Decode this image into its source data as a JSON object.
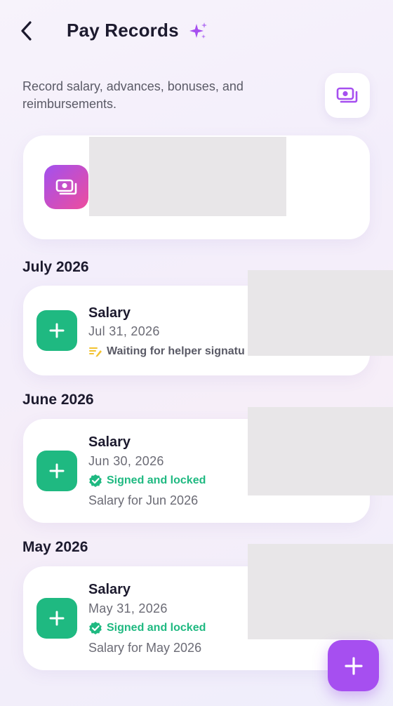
{
  "header": {
    "title": "Pay Records",
    "back_icon": "chevron-left-icon",
    "title_icon": "sparkle-icon"
  },
  "subtitle": "Record salary, advances, bonuses, and reimbursements.",
  "top_action": {
    "icon": "cash-icon"
  },
  "summary_card": {
    "icon": "cash-icon"
  },
  "sections": [
    {
      "title": "July 2026",
      "record": {
        "title": "Salary",
        "date": "Jul 31, 2026",
        "status": "Waiting for helper signatu",
        "status_icon": "signature-pending-icon",
        "status_color": "#5a5a66"
      }
    },
    {
      "title": "June 2026",
      "record": {
        "title": "Salary",
        "date": "Jun 30, 2026",
        "status": "Signed and locked",
        "status_icon": "verified-badge-icon",
        "status_color": "#1fb981",
        "note": "Salary for Jun 2026"
      }
    },
    {
      "title": "May 2026",
      "record": {
        "title": "Salary",
        "date": "May 31, 2026",
        "status": "Signed and locked",
        "status_icon": "verified-badge-icon",
        "status_color": "#1fb981",
        "note": "Salary for May 2026"
      }
    }
  ],
  "colors": {
    "accent_purple": "#a64ff0",
    "income_green": "#1fb981",
    "pending_yellow": "#f2c230",
    "text_primary": "#1c1a2e",
    "text_secondary": "#6b6b75"
  },
  "fab": {
    "icon": "plus-icon"
  }
}
